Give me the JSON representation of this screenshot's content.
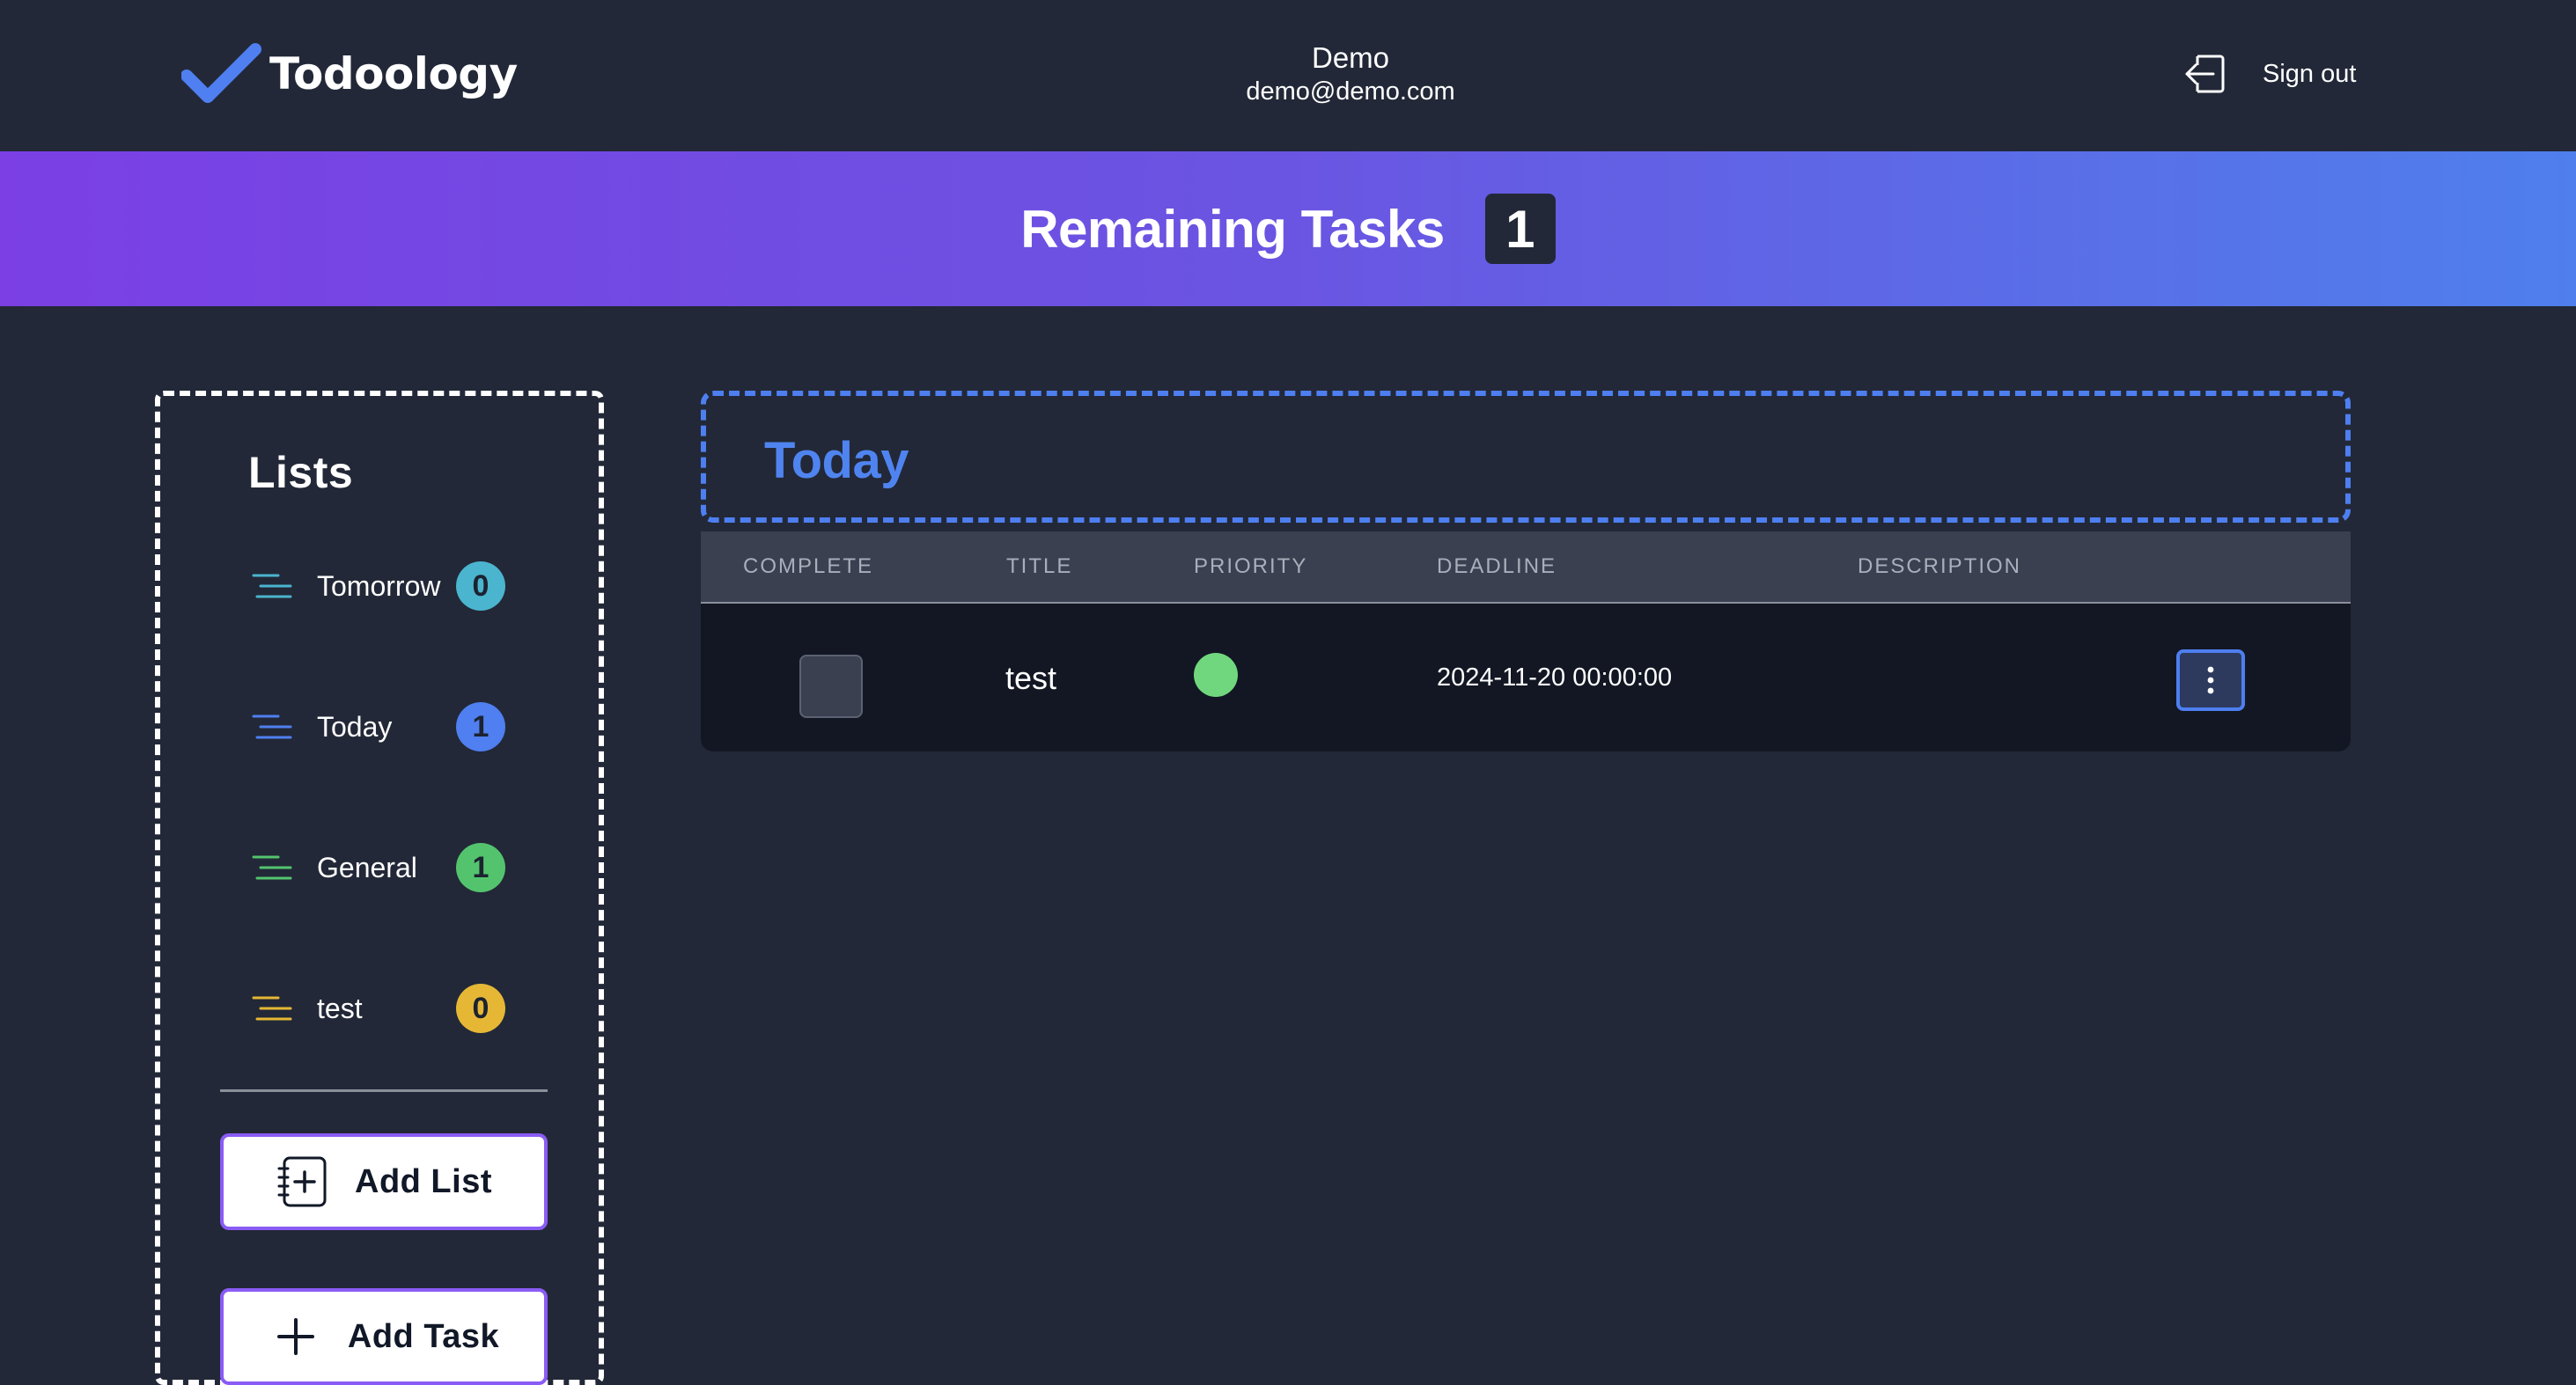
{
  "header": {
    "brand": "Todoology",
    "user_name": "Demo",
    "user_email": "demo@demo.com",
    "signout_label": "Sign out"
  },
  "banner": {
    "title": "Remaining Tasks",
    "count": "1"
  },
  "sidebar": {
    "title": "Lists",
    "items": [
      {
        "label": "Tomorrow",
        "count": "0",
        "color": "#4bb4cf"
      },
      {
        "label": "Today",
        "count": "1",
        "color": "#4f7ff0"
      },
      {
        "label": "General",
        "count": "1",
        "color": "#53c46d"
      },
      {
        "label": "test",
        "count": "0",
        "color": "#e5b735"
      }
    ],
    "add_list_label": "Add List",
    "add_task_label": "Add Task"
  },
  "main": {
    "list_title": "Today",
    "columns": [
      "COMPLETE",
      "TITLE",
      "PRIORITY",
      "DEADLINE",
      "DESCRIPTION"
    ],
    "rows": [
      {
        "complete": false,
        "title": "test",
        "priority": "low",
        "priority_color": "#71d77e",
        "deadline": "2024-11-20 00:00:00",
        "description": ""
      }
    ]
  },
  "colors": {
    "background": "#222837",
    "accent": "#4f7ff0",
    "banner_start": "#7b3fe4",
    "banner_end": "#4f7fec"
  }
}
